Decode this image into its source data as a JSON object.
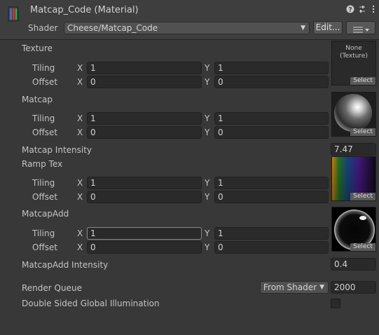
{
  "header": {
    "title": "Matcap_Code (Material)",
    "shader_label": "Shader",
    "shader_value": "Cheese/Matcap_Code",
    "edit_label": "Edit...",
    "help_icon": "help-icon",
    "preset_icon": "sliders-icon",
    "more_icon": "kebab-icon"
  },
  "axis": {
    "x": "X",
    "y": "Y"
  },
  "select_label": "Select",
  "texture": {
    "label": "Texture",
    "tiling_label": "Tiling",
    "offset_label": "Offset",
    "tiling_x": "1",
    "tiling_y": "1",
    "offset_x": "0",
    "offset_y": "0",
    "none_label": "None\n(Texture)"
  },
  "matcap": {
    "label": "Matcap",
    "tiling_label": "Tiling",
    "offset_label": "Offset",
    "tiling_x": "1",
    "tiling_y": "1",
    "offset_x": "0",
    "offset_y": "0"
  },
  "matcap_intensity": {
    "label": "Matcap Intensity",
    "value": "7.47"
  },
  "ramp": {
    "label": "Ramp Tex",
    "tiling_label": "Tiling",
    "offset_label": "Offset",
    "tiling_x": "1",
    "tiling_y": "1",
    "offset_x": "0",
    "offset_y": "0"
  },
  "matcap_add": {
    "label": "MatcapAdd",
    "tiling_label": "Tiling",
    "offset_label": "Offset",
    "tiling_x": "1",
    "tiling_y": "1",
    "offset_x": "0",
    "offset_y": "0"
  },
  "matcap_add_intensity": {
    "label": "MatcapAdd Intensity",
    "value": "0.4"
  },
  "render_queue": {
    "label": "Render Queue",
    "dropdown": "From Shader",
    "value": "2000"
  },
  "double_sided": {
    "label": "Double Sided Global Illumination",
    "checked": false
  },
  "colors": {
    "background": "#383838",
    "header": "#3e3e3e",
    "field": "#2a2a2a"
  }
}
